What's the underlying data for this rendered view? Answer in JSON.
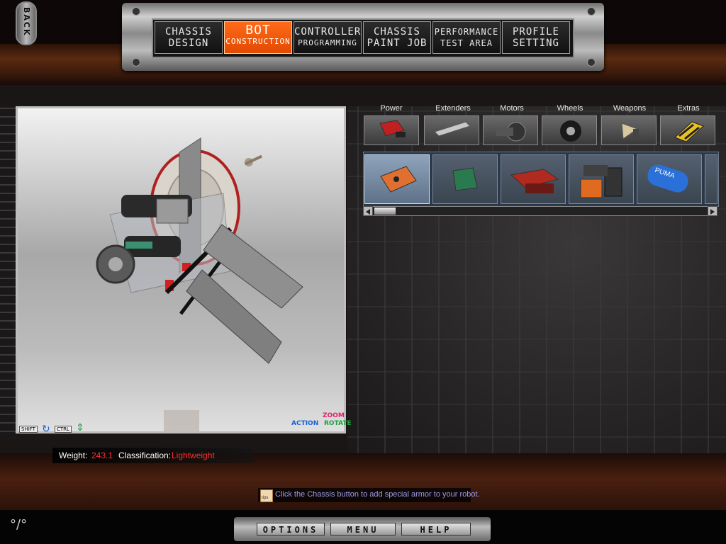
{
  "back_label": "BACK",
  "nav": {
    "tabs": [
      {
        "line1": "CHASSIS",
        "line2": "DESIGN",
        "active": false
      },
      {
        "line1": "BOT",
        "line2": "CONSTRUCTION",
        "active": true
      },
      {
        "line1": "CONTROLLER",
        "line2": "PROGRAMMING",
        "active": false
      },
      {
        "line1": "CHASSIS",
        "line2": "PAINT JOB",
        "active": false
      },
      {
        "line1": "PERFORMANCE",
        "line2": "TEST AREA",
        "active": false
      },
      {
        "line1": "PROFILE",
        "line2": "SETTING",
        "active": false
      }
    ]
  },
  "categories": [
    "Power",
    "Extenders",
    "Motors",
    "Wheels",
    "Weapons",
    "Extras"
  ],
  "parts": [
    {
      "icon": "speed-controller-icon",
      "selected": true
    },
    {
      "icon": "circuit-board-icon",
      "selected": false
    },
    {
      "icon": "battery-pack-icon",
      "selected": false
    },
    {
      "icon": "dual-battery-icon",
      "selected": false
    },
    {
      "icon": "puma-tank-icon",
      "selected": false
    }
  ],
  "viewport": {
    "shift_key": "SHIFT",
    "ctrl_key": "CTRL",
    "action_label": "ACTION",
    "zoom_label": "ZOOM",
    "rotate_label": "ROTATE"
  },
  "status": {
    "weight_label": "Weight:",
    "weight_value": "243.1",
    "classification_label": "Classification:",
    "classification_value": "Lightweight"
  },
  "tip": {
    "icon_label": "tips",
    "text": "Click the Chassis button to add special armor to your robot."
  },
  "menu": {
    "options": "OPTIONS",
    "menu": "MENU",
    "help": "HELP"
  },
  "colors": {
    "accent": "#e85a10",
    "value_red": "#ff3030",
    "tip_text": "#9a9cf0"
  }
}
